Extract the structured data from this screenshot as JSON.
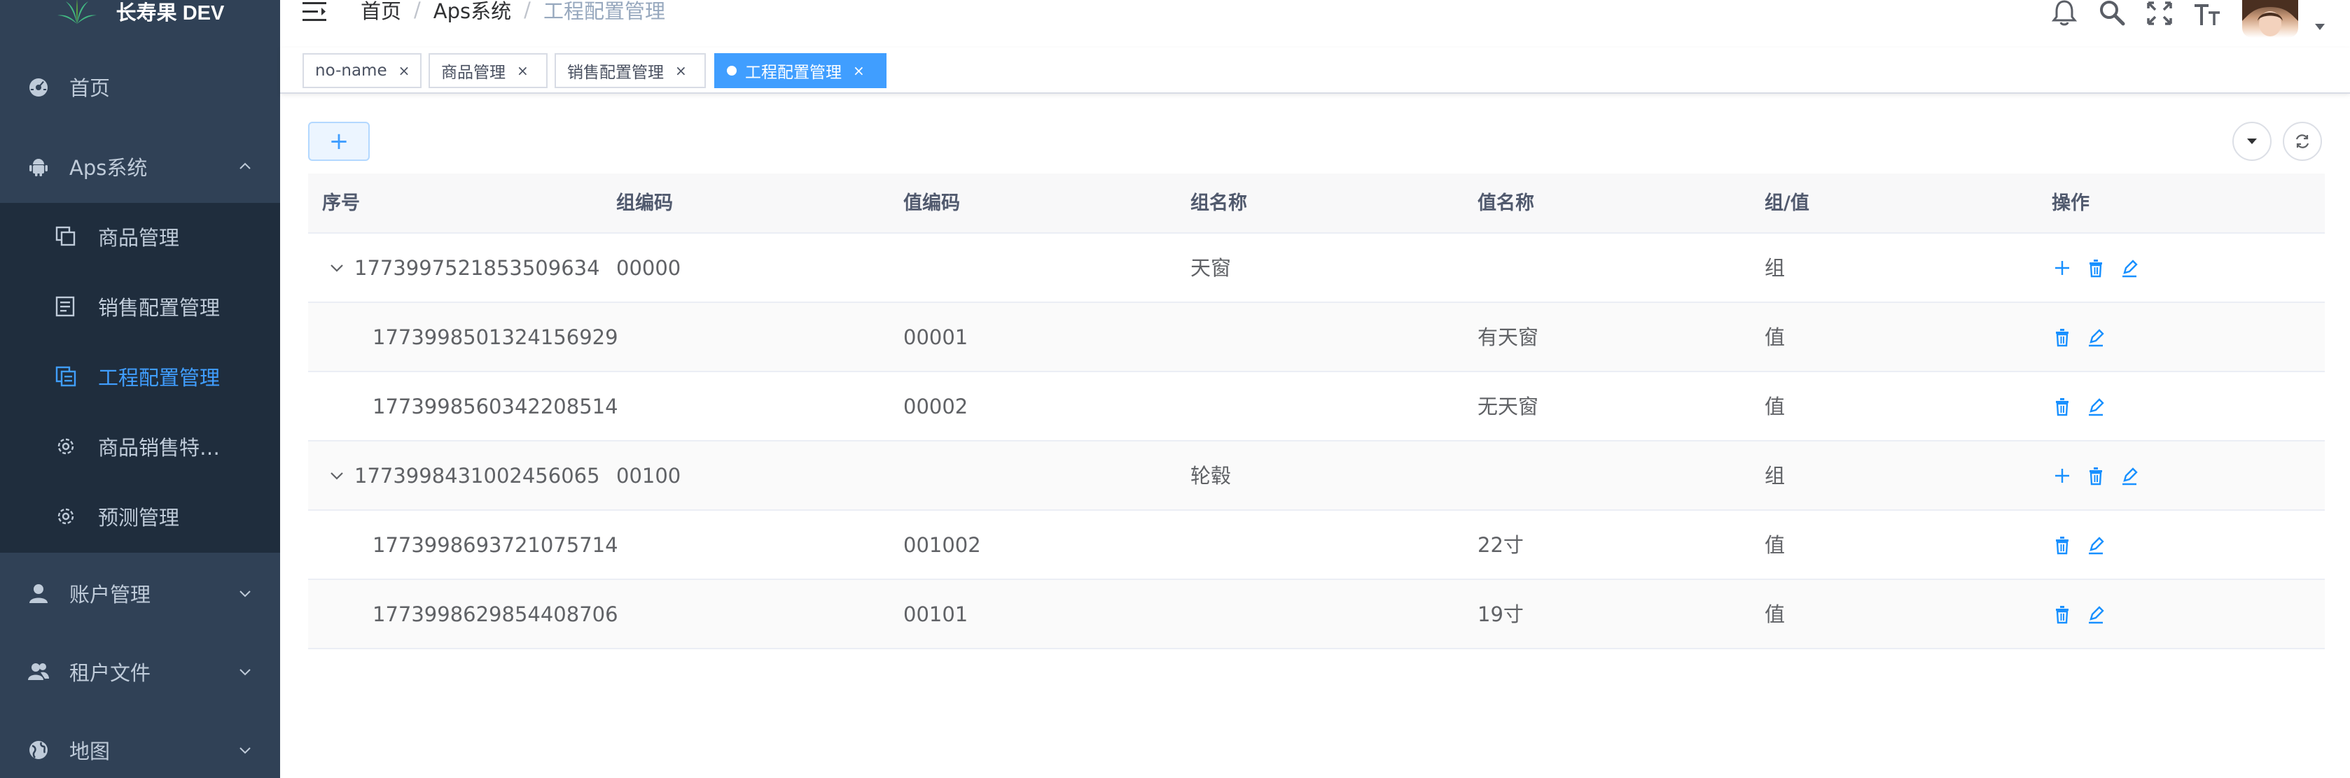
{
  "app": {
    "title": "长寿果 DEV"
  },
  "sidebar": {
    "menu": [
      {
        "label": "首页",
        "icon": "dashboard-icon"
      },
      {
        "label": "Aps系统",
        "icon": "android-icon",
        "expanded": true
      },
      {
        "label": "账户管理",
        "icon": "user-icon"
      },
      {
        "label": "租户文件",
        "icon": "peoples-icon"
      },
      {
        "label": "地图",
        "icon": "globe-icon"
      }
    ],
    "submenu": [
      {
        "label": "商品管理",
        "icon": "copy-icon"
      },
      {
        "label": "销售配置管理",
        "icon": "form-icon"
      },
      {
        "label": "工程配置管理",
        "icon": "documentation-icon",
        "active": true
      },
      {
        "label": "商品销售特…",
        "icon": "gear-icon"
      },
      {
        "label": "预测管理",
        "icon": "gear-icon"
      }
    ]
  },
  "breadcrumb": [
    "首页",
    "Aps系统",
    "工程配置管理"
  ],
  "breadcrumb_sep": "/",
  "tags": [
    {
      "label": "no-name",
      "close": "×"
    },
    {
      "label": "商品管理",
      "close": "×"
    },
    {
      "label": "销售配置管理",
      "close": "×"
    },
    {
      "label": "工程配置管理",
      "close": "×",
      "active": true
    }
  ],
  "toolbar": {
    "add_label": "+"
  },
  "table": {
    "columns": [
      "序号",
      "组编码",
      "值编码",
      "组名称",
      "值名称",
      "组/值",
      "操作"
    ],
    "rows": [
      {
        "id": "1773997521853509634",
        "group_code": "00000",
        "value_code": "",
        "group_name": "天窗",
        "value_name": "",
        "type": "组",
        "level": 0,
        "expandable": true
      },
      {
        "id": "1773998501324156929",
        "group_code": "",
        "value_code": "00001",
        "group_name": "",
        "value_name": "有天窗",
        "type": "值",
        "level": 1,
        "expandable": false
      },
      {
        "id": "1773998560342208514",
        "group_code": "",
        "value_code": "00002",
        "group_name": "",
        "value_name": "无天窗",
        "type": "值",
        "level": 1,
        "expandable": false
      },
      {
        "id": "1773998431002456065",
        "group_code": "00100",
        "value_code": "",
        "group_name": "轮毂",
        "value_name": "",
        "type": "组",
        "level": 0,
        "expandable": true
      },
      {
        "id": "1773998693721075714",
        "group_code": "",
        "value_code": "001002",
        "group_name": "",
        "value_name": "22寸",
        "type": "值",
        "level": 1,
        "expandable": false
      },
      {
        "id": "1773998629854408706",
        "group_code": "",
        "value_code": "00101",
        "group_name": "",
        "value_name": "19寸",
        "type": "值",
        "level": 1,
        "expandable": false
      }
    ]
  },
  "colors": {
    "sidebar_bg": "#304156",
    "submenu_bg": "#1f2d3d",
    "accent": "#409eff",
    "menu_text": "#bfcbd9"
  }
}
